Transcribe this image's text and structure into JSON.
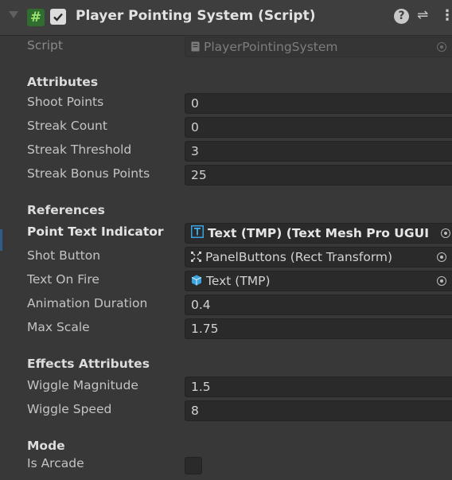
{
  "header": {
    "title": "Player Pointing System (Script)",
    "enabled": true
  },
  "script_row": {
    "label": "Script",
    "value": "PlayerPointingSystem"
  },
  "sections": {
    "attributes": "Attributes",
    "references": "References",
    "effects": "Effects Attributes",
    "mode": "Mode"
  },
  "fields": {
    "shoot_points": {
      "label": "Shoot Points",
      "value": "0"
    },
    "streak_count": {
      "label": "Streak Count",
      "value": "0"
    },
    "streak_threshold": {
      "label": "Streak Threshold",
      "value": "3"
    },
    "streak_bonus_points": {
      "label": "Streak Bonus Points",
      "value": "25"
    },
    "point_text_indicator": {
      "label": "Point Text Indicator",
      "value": "Text (TMP) (Text Mesh Pro UGUI"
    },
    "shot_button": {
      "label": "Shot Button",
      "value": "PanelButtons (Rect Transform)"
    },
    "text_on_fire": {
      "label": "Text On Fire",
      "value": "Text (TMP)"
    },
    "animation_duration": {
      "label": "Animation Duration",
      "value": "0.4"
    },
    "max_scale": {
      "label": "Max Scale",
      "value": "1.75"
    },
    "wiggle_magnitude": {
      "label": "Wiggle Magnitude",
      "value": "1.5"
    },
    "wiggle_speed": {
      "label": "Wiggle Speed",
      "value": "8"
    },
    "is_arcade": {
      "label": "Is Arcade",
      "checked": false
    }
  },
  "colors": {
    "background": "#383838",
    "header": "#3e3e3e",
    "field": "#2a2a2a",
    "tmp_icon": "#3aa3e0",
    "script_icon_bg": "#2f6e2f"
  }
}
